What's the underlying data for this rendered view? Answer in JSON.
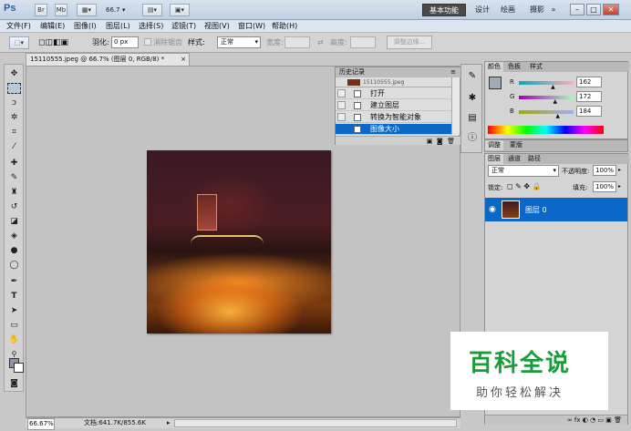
{
  "titlebar": {
    "logo": "Ps",
    "bridge_button": "Br",
    "minibridge_button": "Mb",
    "zoom": "66.7",
    "workspaces": [
      "基本功能",
      "设计",
      "绘画",
      "摄影"
    ],
    "more_workspaces": "»"
  },
  "menu": [
    "文件(F)",
    "编辑(E)",
    "图像(I)",
    "图层(L)",
    "选择(S)",
    "滤镜(T)",
    "视图(V)",
    "窗口(W)",
    "帮助(H)"
  ],
  "options": {
    "feather_label": "羽化:",
    "feather_value": "0 px",
    "antialias_label": "消除锯齿",
    "style_label": "样式:",
    "style_value": "正常",
    "width_label": "宽度:",
    "height_label": "高度:",
    "refine_button": "调整边缘..."
  },
  "document": {
    "tab_title": "15110555.jpeg @ 66.7% (图层 0, RGB/8) *",
    "status_zoom": "66.67%",
    "status_doc": "文档:641.7K/855.6K"
  },
  "history": {
    "tab": "历史记录",
    "snapshot": "15110555.jpeg",
    "items": [
      "打开",
      "建立图层",
      "转换为智能对象",
      "图像大小"
    ]
  },
  "color_panel": {
    "tabs": [
      "颜色",
      "色板",
      "样式"
    ],
    "r_label": "R",
    "g_label": "G",
    "b_label": "B",
    "r": "162",
    "g": "172",
    "b": "184",
    "r_fraction": 0.635,
    "g_fraction": 0.675,
    "b_fraction": 0.722
  },
  "adjust_panel": {
    "tabs": [
      "调整",
      "蒙版"
    ]
  },
  "layers_panel": {
    "tabs": [
      "图层",
      "通道",
      "路径"
    ],
    "blend_mode": "正常",
    "opacity_label": "不透明度:",
    "opacity": "100%",
    "lock_label": "锁定:",
    "fill_label": "填充:",
    "fill": "100%",
    "layer_name": "图层 0"
  },
  "watermark": {
    "title": "百科全说",
    "subtitle": "助你轻松解决"
  },
  "colors": {
    "selection": "#0a68c8",
    "watermark_green": "#1b9c3a"
  }
}
